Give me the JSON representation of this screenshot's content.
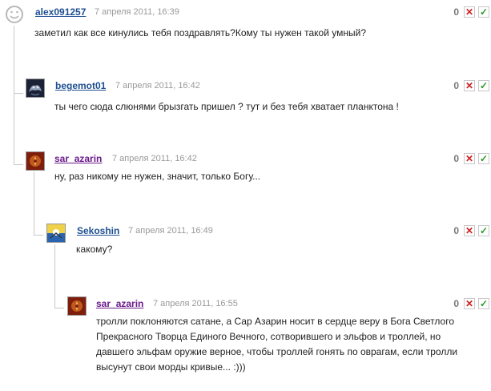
{
  "comments": [
    {
      "author": "alex091257",
      "date": "7 апреля 2011, 16:39",
      "score": "0",
      "text": "заметил как все кинулись тебя поздравлять?Кому ты нужен такой умный?"
    },
    {
      "author": "begemot01",
      "date": "7 апреля 2011, 16:42",
      "score": "0",
      "text": "ты чего сюда слюнями брызгать пришел ? тут и без тебя хватает планктона !"
    },
    {
      "author": "sar_azarin",
      "date": "7 апреля 2011, 16:42",
      "score": "0",
      "text": "ну, раз никому не нужен, значит, только Богу..."
    },
    {
      "author": "Sekoshin",
      "date": "7 апреля 2011, 16:49",
      "score": "0",
      "text": "какому?"
    },
    {
      "author": "sar_azarin",
      "date": "7 апреля 2011, 16:55",
      "score": "0",
      "text": "тролли поклоняются сатане, а Сар Азарин носит в сердце веру в Бога Светлого Прекрасного Творца Единого Вечного, сотворившего и эльфов и троллей, но давшего эльфам оружие верное, чтобы троллей гонять по оврагам, если тролли высунут свои морды кривые... :)))"
    }
  ],
  "vote_down_glyph": "✕",
  "vote_up_glyph": "✓",
  "colors": {
    "author_link": "#1d4f91",
    "author_visited": "#6a1b8a",
    "vote_down": "#cc2222",
    "vote_up": "#2a9a2a",
    "thread_line": "#c8c8c8"
  }
}
